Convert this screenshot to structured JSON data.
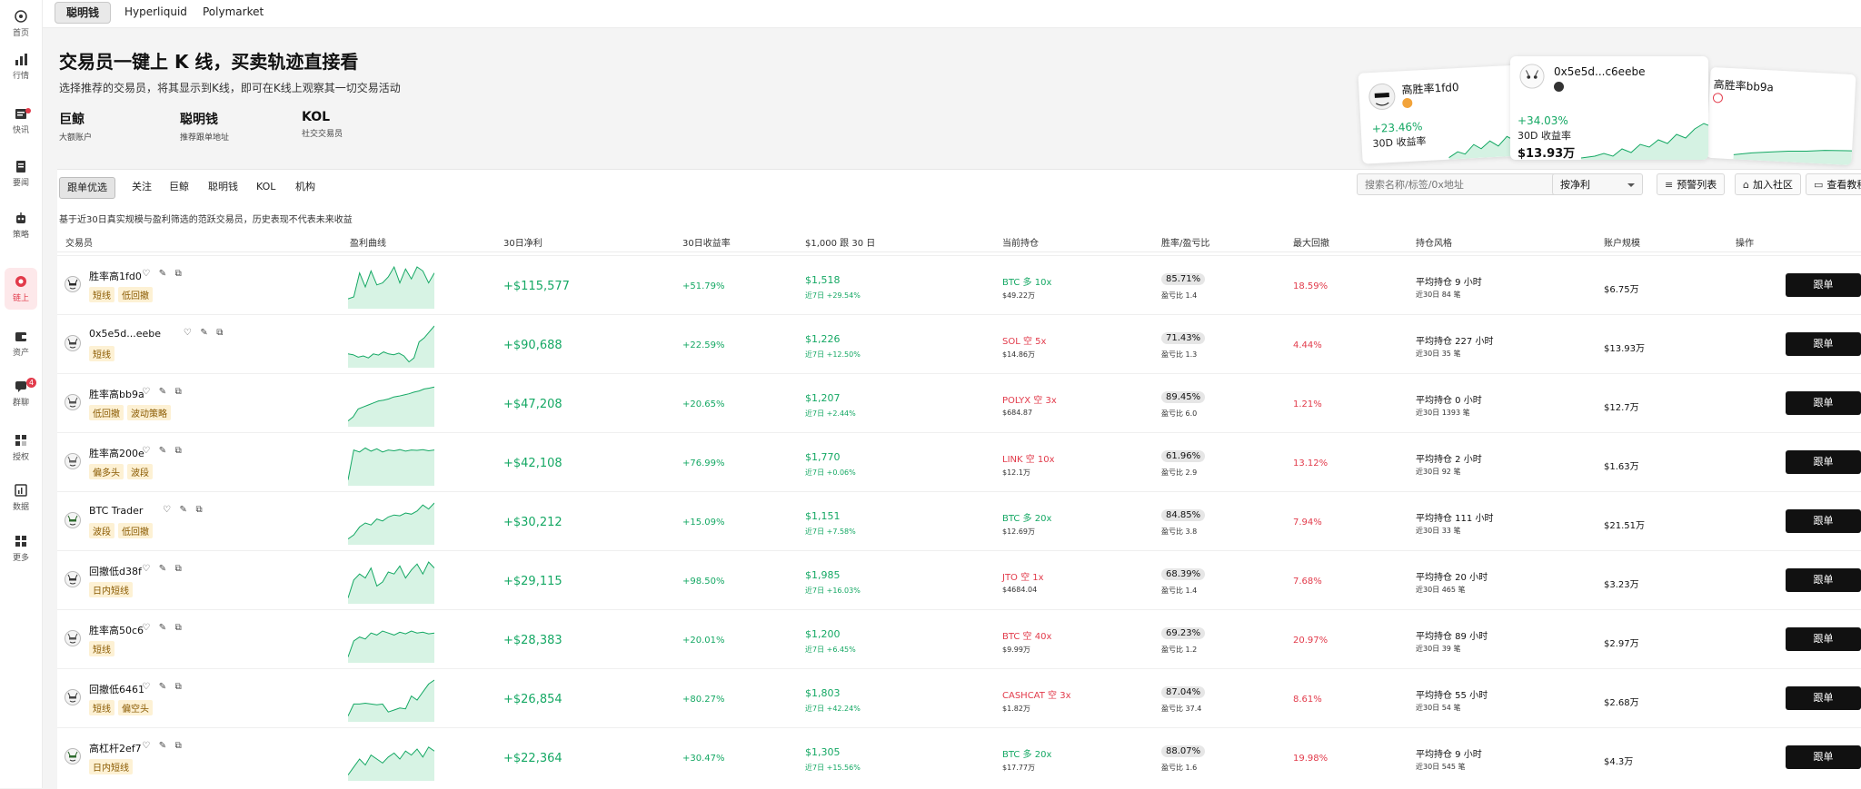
{
  "colors": {
    "accent": "#e23b4b",
    "positive": "#15a864",
    "negative": "#e23b4b"
  },
  "sidebar": {
    "items": [
      {
        "label": "首页",
        "icon": "home-icon"
      },
      {
        "label": "行情",
        "icon": "chart-icon"
      },
      {
        "label": "快讯",
        "icon": "news-icon"
      },
      {
        "label": "要闻",
        "icon": "document-icon"
      },
      {
        "label": "策略",
        "icon": "robot-icon"
      },
      {
        "label": "链上",
        "icon": "chain-icon"
      },
      {
        "label": "资产",
        "icon": "wallet-icon"
      },
      {
        "label": "群聊",
        "icon": "chat-icon",
        "badge": "4"
      },
      {
        "label": "授权",
        "icon": "key-icon"
      },
      {
        "label": "数据",
        "icon": "data-icon"
      },
      {
        "label": "更多",
        "icon": "grid-icon"
      }
    ]
  },
  "tabs": [
    "聪明钱",
    "Hyperliquid",
    "Polymarket"
  ],
  "hero": {
    "title": "交易员一键上 K 线，买卖轨迹直接看",
    "subtitle": "选择推荐的交易员，将其显示到K线，即可在K线上观察其一切交易活动",
    "categories": [
      {
        "title": "巨鲸",
        "subtitle": "大额账户"
      },
      {
        "title": "聪明钱",
        "subtitle": "推荐跟单地址"
      },
      {
        "title": "KOL",
        "subtitle": "社交交易员"
      }
    ],
    "cards": [
      {
        "name": "高胜率1fd0",
        "pct": "+23.46%",
        "label": "30D 收益率"
      },
      {
        "name": "0x5e5d...c6eebe",
        "pct": "+34.03%",
        "label": "30D 收益率",
        "amount": "$13.93万"
      },
      {
        "name": "高胜率bb9a"
      }
    ]
  },
  "filters": [
    "跟单优选",
    "关注",
    "巨鲸",
    "聪明钱",
    "KOL",
    "机构"
  ],
  "search": {
    "placeholder": "搜索名称/标签/0x地址"
  },
  "sort": {
    "value": "按净利"
  },
  "toolbar": {
    "alerts": "预警列表",
    "community": "加入社区",
    "tutorial": "查看教程"
  },
  "notice": "基于近30日真实规模与盈利筛选的范跃交易员，历史表现不代表未来收益",
  "columns": [
    "交易员",
    "盈利曲线",
    "30日净利",
    "30日收益率",
    "$1,000 跟 30 日",
    "当前持仓",
    "胜率/盈亏比",
    "最大回撤",
    "持仓风格",
    "账户规模",
    "操作"
  ],
  "follow_label": "跟单",
  "rows": [
    {
      "name": "胜率高1fd0",
      "tags": [
        "短线",
        "低回撤"
      ],
      "pnl": "+$115,577",
      "roi": "+51.79%",
      "k1": "$1,518",
      "k2": "近7日 +29.54%",
      "hold": "BTC 多 10x",
      "hold_dir": "long",
      "hold_val": "$49.22万",
      "wr": "85.71%",
      "pf": "盈亏比 1.4",
      "dd": "18.59%",
      "st1": "平均持仓 9 小时",
      "st2": "近30日 84 笔",
      "acc": "$6.75万",
      "curve": [
        0.2,
        0.25,
        0.85,
        0.5,
        0.9,
        0.55,
        0.6,
        0.75,
        1.0,
        0.6,
        0.95,
        0.7,
        1.0,
        0.9,
        0.6,
        0.85
      ]
    },
    {
      "name": "0x5e5d...eebe",
      "tags": [
        "短线"
      ],
      "pnl": "+$90,688",
      "roi": "+22.59%",
      "k1": "$1,226",
      "k2": "近7日 +12.50%",
      "hold": "SOL 空 5x",
      "hold_dir": "short",
      "hold_val": "$14.86万",
      "wr": "71.43%",
      "pf": "盈亏比 1.3",
      "dd": "4.44%",
      "st1": "平均持仓 227 小时",
      "st2": "近30日 35 笔",
      "acc": "$13.93万",
      "curve": [
        0.3,
        0.28,
        0.22,
        0.25,
        0.2,
        0.3,
        0.27,
        0.35,
        0.3,
        0.28,
        0.32,
        0.25,
        0.1,
        0.2,
        0.6,
        0.7,
        0.85,
        1.0
      ]
    },
    {
      "name": "胜率高bb9a",
      "tags": [
        "低回撤",
        "波动策略"
      ],
      "pnl": "+$47,208",
      "roi": "+20.65%",
      "k1": "$1,207",
      "k2": "近7日 +2.44%",
      "hold": "POLYX 空 3x",
      "hold_dir": "short",
      "hold_val": "$684.87",
      "wr": "89.45%",
      "pf": "盈亏比 6.0",
      "dd": "1.21%",
      "st1": "平均持仓 0 小时",
      "st2": "近30日 1393 笔",
      "acc": "$12.7万",
      "curve": [
        0.1,
        0.2,
        0.4,
        0.45,
        0.5,
        0.55,
        0.6,
        0.62,
        0.65,
        0.7,
        0.72,
        0.75,
        0.78,
        0.82,
        0.85,
        0.9,
        0.92,
        0.95
      ]
    },
    {
      "name": "胜率高200e",
      "tags": [
        "偏多头",
        "波段"
      ],
      "pnl": "+$42,108",
      "roi": "+76.99%",
      "k1": "$1,770",
      "k2": "近7日 +0.06%",
      "hold": "LINK 空 10x",
      "hold_dir": "short",
      "hold_val": "$12.1万",
      "wr": "61.96%",
      "pf": "盈亏比 2.9",
      "dd": "13.12%",
      "st1": "平均持仓 2 小时",
      "st2": "近30日 92 笔",
      "acc": "$1.63万",
      "curve": [
        0.1,
        0.85,
        0.8,
        0.9,
        0.82,
        0.88,
        0.8,
        0.85,
        0.83,
        0.86,
        0.82,
        0.85,
        0.84,
        0.86,
        0.83,
        0.85
      ]
    },
    {
      "name": "BTC Trader",
      "tags": [
        "波段",
        "低回撤"
      ],
      "pnl": "+$30,212",
      "roi": "+15.09%",
      "k1": "$1,151",
      "k2": "近7日 +7.58%",
      "hold": "BTC 多 20x",
      "hold_dir": "long",
      "hold_val": "$12.69万",
      "wr": "84.85%",
      "pf": "盈亏比 3.8",
      "dd": "7.94%",
      "st1": "平均持仓 111 小时",
      "st2": "近30日 33 笔",
      "acc": "$21.51万",
      "curve": [
        0.1,
        0.2,
        0.4,
        0.5,
        0.45,
        0.6,
        0.55,
        0.65,
        0.7,
        0.68,
        0.75,
        0.72,
        0.8,
        0.95,
        0.85,
        1.0
      ]
    },
    {
      "name": "回撤低d38f",
      "tags": [
        "日内短线"
      ],
      "pnl": "+$29,115",
      "roi": "+98.50%",
      "k1": "$1,985",
      "k2": "近7日 +16.03%",
      "hold": "JTO 空 1x",
      "hold_dir": "short",
      "hold_val": "$4684.04",
      "wr": "68.39%",
      "pf": "盈亏比 1.4",
      "dd": "7.68%",
      "st1": "平均持仓 20 小时",
      "st2": "近30日 465 笔",
      "acc": "$3.23万",
      "curve": [
        0.1,
        0.55,
        0.7,
        0.6,
        0.85,
        0.4,
        0.5,
        0.75,
        0.7,
        0.9,
        0.6,
        0.8,
        0.95,
        0.7,
        1.0,
        0.85
      ]
    },
    {
      "name": "胜率高50c6",
      "tags": [
        "短线"
      ],
      "pnl": "+$28,383",
      "roi": "+20.01%",
      "k1": "$1,200",
      "k2": "近7日 +6.45%",
      "hold": "BTC 空 40x",
      "hold_dir": "short",
      "hold_val": "$9.99万",
      "wr": "69.23%",
      "pf": "盈亏比 1.2",
      "dd": "20.97%",
      "st1": "平均持仓 89 小时",
      "st2": "近30日 39 笔",
      "acc": "$2.97万",
      "curve": [
        0.1,
        0.5,
        0.6,
        0.55,
        0.7,
        0.65,
        0.75,
        0.7,
        0.65,
        0.72,
        0.68,
        0.75,
        0.7,
        0.72,
        0.68,
        0.7
      ]
    },
    {
      "name": "回撤低6461",
      "tags": [
        "短线",
        "偏空头"
      ],
      "pnl": "+$26,854",
      "roi": "+80.27%",
      "k1": "$1,803",
      "k2": "近7日 +42.24%",
      "hold": "CASHCAT 空 3x",
      "hold_dir": "short",
      "hold_val": "$1.82万",
      "wr": "87.04%",
      "pf": "盈亏比 37.4",
      "dd": "8.61%",
      "st1": "平均持仓 55 小时",
      "st2": "近30日 54 笔",
      "acc": "$2.68万",
      "curve": [
        0.1,
        0.4,
        0.4,
        0.42,
        0.4,
        0.38,
        0.4,
        0.2,
        0.25,
        0.3,
        0.28,
        0.6,
        0.5,
        0.7,
        0.9,
        1.0
      ]
    },
    {
      "name": "高杠杆2ef7",
      "tags": [
        "日内短线"
      ],
      "pnl": "+$22,364",
      "roi": "+30.47%",
      "k1": "$1,305",
      "k2": "近7日 +15.56%",
      "hold": "BTC 多 20x",
      "hold_dir": "long",
      "hold_val": "$17.77万",
      "wr": "88.07%",
      "pf": "盈亏比 1.6",
      "dd": "19.98%",
      "st1": "平均持仓 9 小时",
      "st2": "近30日 545 笔",
      "acc": "$4.3万",
      "curve": [
        0.1,
        0.3,
        0.5,
        0.35,
        0.6,
        0.5,
        0.4,
        0.55,
        0.65,
        0.5,
        0.7,
        0.6,
        0.75,
        0.55,
        0.8,
        0.7
      ]
    }
  ]
}
